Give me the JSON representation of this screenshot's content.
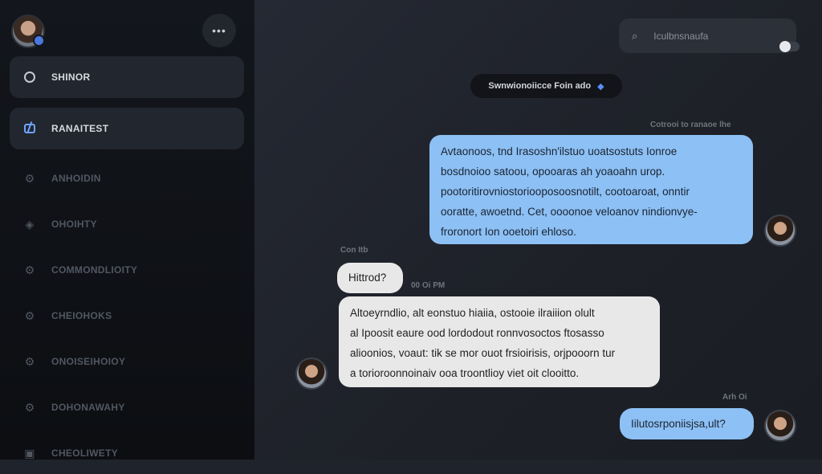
{
  "sidebar": {
    "menu_label": "•••",
    "items": [
      {
        "label": "SHINOR",
        "icon": "circle-icon",
        "state": "active"
      },
      {
        "label": "RANAITEST",
        "icon": "chat-grid-icon",
        "state": "active"
      },
      {
        "label": "ANHOIDIN",
        "icon": "gear-icon",
        "state": "dim"
      },
      {
        "label": "OHOIHTY",
        "icon": "diamond-icon",
        "state": "dim"
      },
      {
        "label": "COMMONDLIOITY",
        "icon": "gear-icon",
        "state": "dim"
      },
      {
        "label": "CHEIOHOKS",
        "icon": "gear-icon",
        "state": "dim"
      },
      {
        "label": "ONOISEIHOIOY",
        "icon": "gear-icon",
        "state": "dim"
      },
      {
        "label": "DOHONAWAHY",
        "icon": "gear-icon",
        "state": "dim"
      },
      {
        "label": "CHEOLIWETY",
        "icon": "box-icon",
        "state": "dim"
      }
    ]
  },
  "search": {
    "icon_label": "⌕",
    "placeholder": "Iculbnsnaufa"
  },
  "chat": {
    "date_pill": "Swnwionoiicce Foin ado",
    "messages": [
      {
        "id": "m1",
        "direction": "out",
        "timestamp": "Cotrooi to ranaoe lhe",
        "lines": [
          "Avtaonoos, tnd Irasoshn'ilstuo uoatsostuts Ionroe",
          "bosdnoioo satoou, opooaras ah yoaoahn urop.",
          "pootoritirovniostoriooposoosnotilt, cootoaroat, onntir",
          "ooratte, awoetnd. Cet, oooonoe veloanov nindionvye-",
          "froronort Ion ooetoiri ehloso."
        ]
      },
      {
        "id": "m2",
        "direction": "in",
        "timestamp": "Con Itb",
        "lines": [
          "Hittrod?"
        ]
      },
      {
        "id": "m3",
        "direction": "in",
        "timestamp": "00 Oi PM",
        "lines": [
          "Altoeyrndlio, alt eonstuo hiaiia, ostooie ilraiiion olult",
          "al Ipoosit eaure  ood lordodout ronnvosoctos ftosasso",
          "alioonios, voaut: tik se mor ouot frsioirisis, orjpooorn tur",
          "a torioroonnoinaiv ooa troontlioy viet oit clooitto."
        ]
      },
      {
        "id": "m4",
        "direction": "out",
        "timestamp": "Arh Oi",
        "lines": [
          "Iilutosrponiisjsa,ult?"
        ]
      }
    ]
  },
  "colors": {
    "outgoing_bubble": "#8dc0f4",
    "incoming_bubble": "#e8e8e8",
    "accent": "#5a8dff"
  }
}
